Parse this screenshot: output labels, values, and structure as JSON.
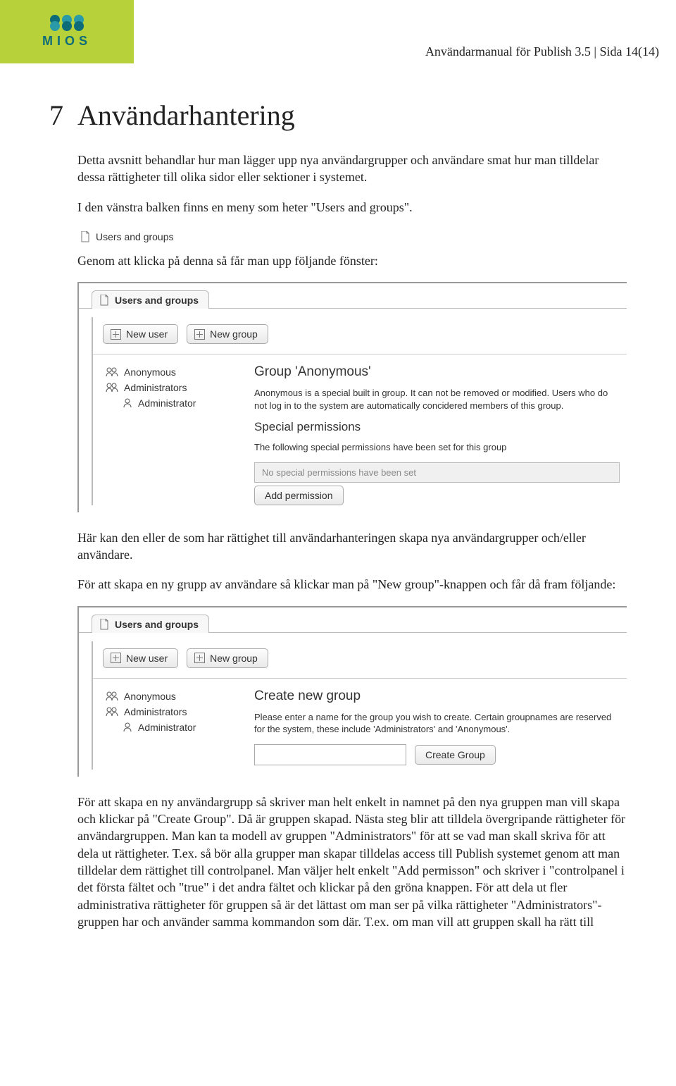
{
  "header": {
    "brand": "MIOS",
    "doc_title": "Användarmanual för Publish 3.5 | Sida 14(14)"
  },
  "section": {
    "number": "7",
    "title": "Användarhantering"
  },
  "paras": {
    "p1": "Detta avsnitt behandlar hur man lägger upp nya användargrupper och användare smat hur man tilldelar dessa rättigheter till olika sidor eller sektioner i systemet.",
    "p2": "I den vänstra balken finns en meny som heter \"Users and groups\".",
    "p3": "Genom att klicka på denna så får man upp följande fönster:",
    "p4": "Här kan den eller de som har rättighet till användarhanteringen skapa nya användargrupper och/eller användare.",
    "p5": "För att skapa en ny grupp av användare så klickar man på \"New group\"-knappen och får då fram följande:",
    "p6": "För att skapa en ny användargrupp så skriver man helt enkelt in namnet på den nya gruppen man vill skapa och klickar på \"Create Group\". Då är gruppen skapad. Nästa steg blir att tilldela övergripande rättigheter för användargruppen. Man kan ta modell av gruppen \"Administrators\" för att se vad man skall skriva för att dela ut rättigheter. T.ex. så bör alla grupper man skapar tilldelas access till Publish systemet genom att man tilldelar dem rättighet till controlpanel. Man väljer helt enkelt \"Add permisson\" och skriver i \"controlpanel i det första fältet och \"true\" i det andra fältet och klickar på den gröna knappen. För att dela ut fler administrativa rättigheter för gruppen så är det lättast om man ser på vilka rättigheter \"Administrators\"-gruppen har och använder samma kommandon som där. T.ex. om man vill att gruppen skall ha rätt till"
  },
  "ui": {
    "users_groups_link": "Users and groups",
    "window_tab": "Users and groups",
    "new_user": "New user",
    "new_group": "New group",
    "tree": {
      "anonymous": "Anonymous",
      "administrators": "Administrators",
      "administrator": "Administrator"
    },
    "pane1": {
      "heading": "Group 'Anonymous'",
      "desc": "Anonymous is a special built in group. It can not be removed or modified. Users who do not log in to the system are automatically concidered members of this group.",
      "sp_heading": "Special permissions",
      "sp_desc": "The following special permissions have been set for this group",
      "sp_box": "No special permissions have been set",
      "add_perm": "Add permission"
    },
    "pane2": {
      "heading": "Create new group",
      "desc": "Please enter a name for the group you wish to create. Certain groupnames are reserved for the system, these include 'Administrators' and 'Anonymous'.",
      "create": "Create Group"
    }
  }
}
